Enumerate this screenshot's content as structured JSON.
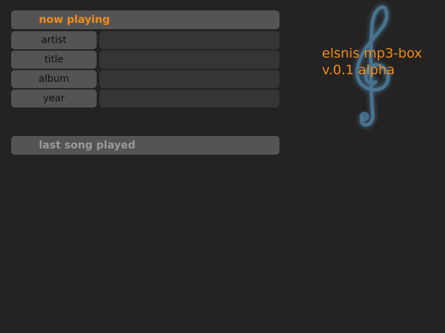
{
  "now_playing": {
    "title": "now playing",
    "fields": [
      {
        "label": "artist",
        "value": ""
      },
      {
        "label": "title",
        "value": ""
      },
      {
        "label": "album",
        "value": ""
      },
      {
        "label": "year",
        "value": ""
      }
    ]
  },
  "last_song": {
    "title": "last song played"
  },
  "app": {
    "name": "elsnis mp3-box",
    "version": "v.0.1 alpha"
  },
  "colors": {
    "accent": "#f08c1c",
    "background": "#242222",
    "panel": "#555454",
    "field": "#363535",
    "clef": "#4a7896"
  },
  "icons": {
    "logo": "treble-clef-icon"
  }
}
